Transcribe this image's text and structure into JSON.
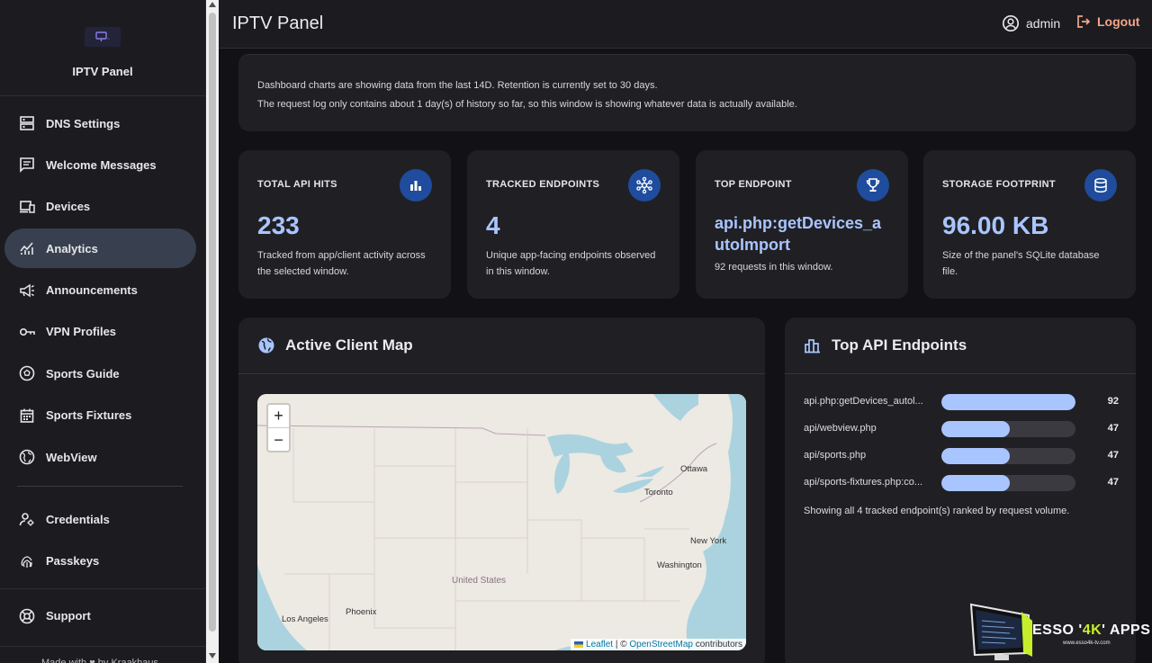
{
  "app": {
    "name": "IPTV Panel",
    "header_title": "IPTV Panel"
  },
  "sidebar": {
    "items": [
      {
        "label": "DNS Settings",
        "icon": "dns-icon"
      },
      {
        "label": "Welcome Messages",
        "icon": "message-icon"
      },
      {
        "label": "Devices",
        "icon": "devices-icon"
      },
      {
        "label": "Analytics",
        "icon": "analytics-icon",
        "active": true
      },
      {
        "label": "Announcements",
        "icon": "megaphone-icon"
      },
      {
        "label": "VPN Profiles",
        "icon": "key-icon"
      },
      {
        "label": "Sports Guide",
        "icon": "soccer-ball-icon"
      },
      {
        "label": "Sports Fixtures",
        "icon": "calendar-icon"
      },
      {
        "label": "WebView",
        "icon": "globe-icon"
      }
    ],
    "secondary": [
      {
        "label": "Credentials",
        "icon": "user-settings-icon"
      },
      {
        "label": "Passkeys",
        "icon": "fingerprint-icon"
      }
    ],
    "support": {
      "label": "Support",
      "icon": "lifebuoy-icon"
    },
    "footer": "Made with ♥ by Kraakhaus"
  },
  "header": {
    "user": "admin",
    "logout": "Logout"
  },
  "notice": {
    "line1": "Dashboard charts are showing data from the last 14D. Retention is currently set to 30 days.",
    "line2": "The request log only contains about 1 day(s) of history so far, so this window is showing whatever data is actually available."
  },
  "stats": [
    {
      "label": "TOTAL API HITS",
      "value": "233",
      "desc": "Tracked from app/client activity across the selected window.",
      "icon": "bar-chart-icon"
    },
    {
      "label": "TRACKED ENDPOINTS",
      "value": "4",
      "desc": "Unique app-facing endpoints observed in this window.",
      "icon": "hub-icon"
    },
    {
      "label": "TOP ENDPOINT",
      "value": "api.php:getDevices_autoImport",
      "desc": "92 requests in this window.",
      "icon": "trophy-icon"
    },
    {
      "label": "STORAGE FOOTPRINT",
      "value": "96.00 KB",
      "desc": "Size of the panel's SQLite database file.",
      "icon": "database-icon"
    }
  ],
  "map_panel": {
    "title": "Active Client Map",
    "zoom_in": "+",
    "zoom_out": "−",
    "places": {
      "ottawa": "Ottawa",
      "toronto": "Toronto",
      "new_york": "New York",
      "washington": "Washington",
      "united_states": "United States",
      "phoenix": "Phoenix",
      "los_angeles": "Los Angeles"
    },
    "attribution": {
      "leaflet": "Leaflet",
      "sep": " | © ",
      "osm": "OpenStreetMap",
      "contrib": " contributors"
    }
  },
  "endpoints_panel": {
    "title": "Top API Endpoints",
    "rows": [
      {
        "name": "api.php:getDevices_autoImport",
        "display": "api.php:getDevices_autol...",
        "count": 92
      },
      {
        "name": "api/webview.php",
        "display": "api/webview.php",
        "count": 47
      },
      {
        "name": "api/sports.php",
        "display": "api/sports.php",
        "count": 47
      },
      {
        "name": "api/sports-fixtures.php:co...",
        "display": "api/sports-fixtures.php:co...",
        "count": 47
      }
    ],
    "max": 92,
    "footer": "Showing all 4 tracked endpoint(s) ranked by request volume."
  },
  "watermark": {
    "pre": "ESSO '",
    "hl": "4K",
    "post": "' APPS",
    "sub": "www.esso4k-tv.com"
  },
  "colors": {
    "accent": "#a9c5ff",
    "icon_bg": "#1f4c9c",
    "logout": "#f4a58a",
    "active_nav": "#38404f"
  }
}
